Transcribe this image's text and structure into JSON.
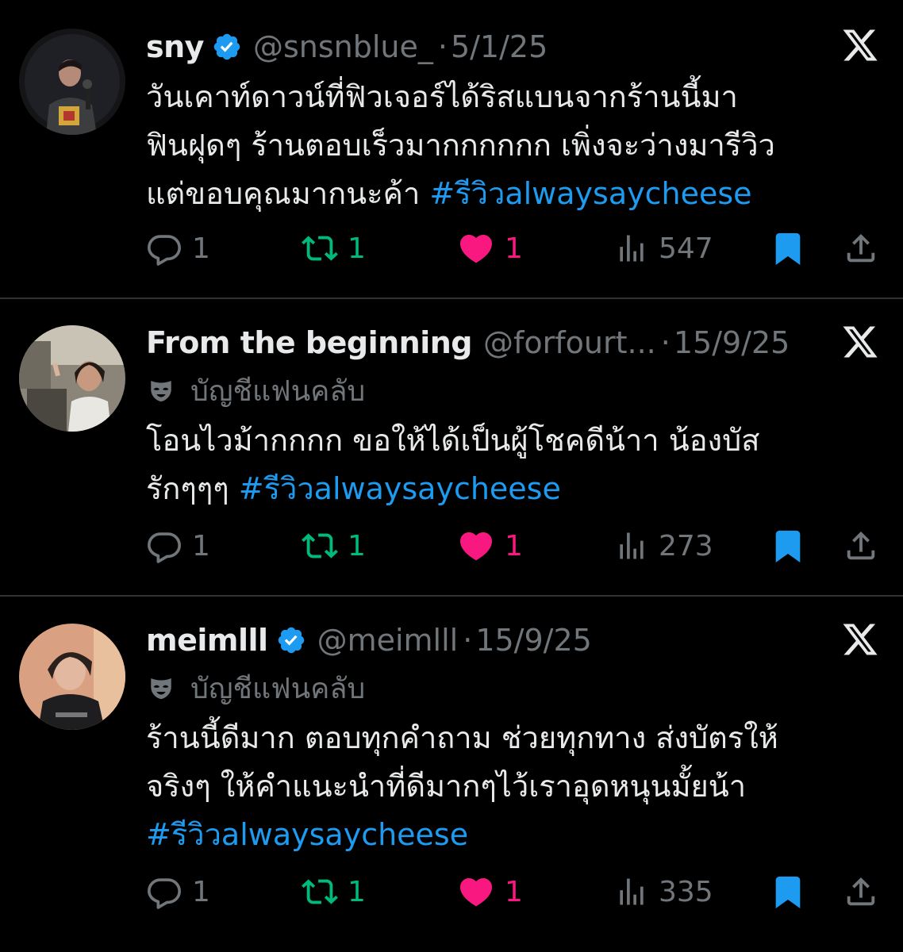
{
  "tweets": [
    {
      "display_name": "sny",
      "verified": true,
      "handle": "@snsnblue_",
      "separator": "·",
      "date": "5/1/25",
      "fanclub_label": "",
      "body_lines": [
        "วันเคาท์ดาวน์ที่ฟิวเจอร์ได้ริสแบนจากร้านนี้มา",
        "ฟินฝุดๆ ร้านตอบเร็วมากกกกกก เพิ่งจะว่างมารีวิว",
        "แต่ขอบคุณมากนะค้า"
      ],
      "hashtag": "#รีวิวalwaysaycheese",
      "replies": "1",
      "retweets": "1",
      "likes": "1",
      "views": "547"
    },
    {
      "display_name": "From the beginning",
      "verified": false,
      "handle": "@forfourt...",
      "separator": "·",
      "date": "15/9/25",
      "fanclub_label": "บัญชีแฟนคลับ",
      "body_lines": [
        "โอนไวม้ากกกก ขอให้ได้เป็นผู้โชคดีน้าา น้องบัส",
        "รักๆๆๆ"
      ],
      "hashtag": "#รีวิวalwaysaycheese",
      "replies": "1",
      "retweets": "1",
      "likes": "1",
      "views": "273"
    },
    {
      "display_name": "meimlll",
      "verified": true,
      "handle": "@meimlll",
      "separator": "·",
      "date": "15/9/25",
      "fanclub_label": "บัญชีแฟนคลับ",
      "body_lines": [
        "ร้านนี้ดีมาก ตอบทุกคำถาม  ช่วยทุกทาง ส่งบัตรให้",
        "จริงๆ  ให้คำแนะนำที่ดีมากๆไว้เราอุดหนุนมั้ยน้า"
      ],
      "hashtag": "#รีวิวalwaysaycheese",
      "replies": "1",
      "retweets": "1",
      "likes": "1",
      "views": "335"
    }
  ],
  "icons": {
    "reply": "reply-icon",
    "retweet": "retweet-icon",
    "like": "heart-icon",
    "views": "views-icon",
    "bookmark": "bookmark-icon",
    "share": "share-icon",
    "platform": "x-logo-icon",
    "verified": "verified-badge-icon",
    "fanclub": "mask-icon"
  },
  "colors": {
    "background": "#000000",
    "text": "#e7e9ea",
    "muted": "#71767b",
    "link": "#1d9bf0",
    "retweet": "#00ba7c",
    "like": "#f91880",
    "bookmark": "#1d9bf0",
    "divider": "#2f3336"
  }
}
